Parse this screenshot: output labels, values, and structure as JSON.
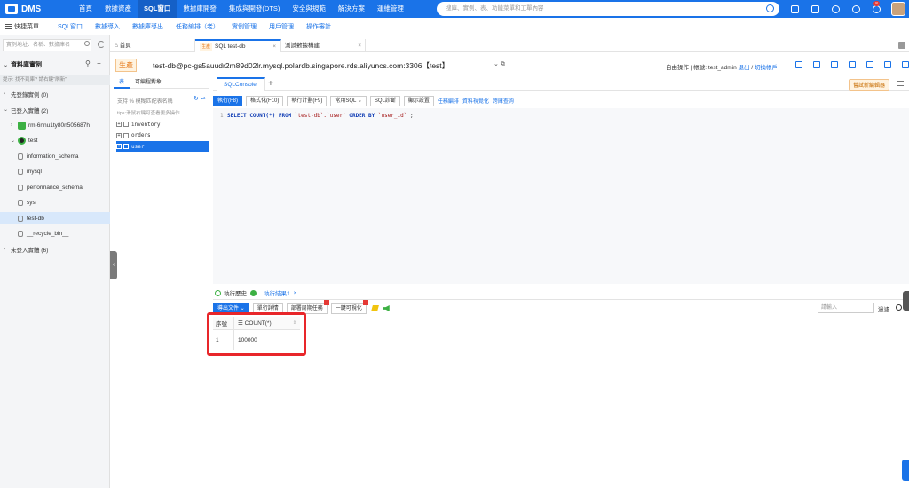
{
  "topnav": {
    "logo": "DMS",
    "items": [
      "首頁",
      "數據資產",
      "SQL窗口",
      "數據庫開發",
      "集成與開發(DTS)",
      "安全與規範",
      "解決方案",
      "運維管理"
    ],
    "active_index": 2,
    "search_placeholder": "搜庫、實例、表、功能菜單和工單內容",
    "notification_count": "8"
  },
  "subnav": {
    "quick_menu": "快捷菜單",
    "items": [
      "SQL窗口",
      "數據導入",
      "數據庫導出",
      "任務編排（老）",
      "實例管理",
      "用戶管理",
      "操作審計"
    ]
  },
  "leftpanel": {
    "search_placeholder": "實例地址、名稱、數據庫名",
    "title": "資料庫實例",
    "hint": "提示: 找不到庫? 請右鍵\"刷新\"",
    "tree": [
      {
        "label": "先登錄實例 (0)",
        "level": 0,
        "arrow": "›"
      },
      {
        "label": "已登入實體 (2)",
        "level": 0,
        "arrow": "⌄"
      },
      {
        "label": "rm-6nnu1ty80n505687h",
        "level": 1,
        "arrow": "›",
        "type": "instance"
      },
      {
        "label": "test",
        "level": 1,
        "arrow": "⌄",
        "type": "instance-dark"
      },
      {
        "label": "information_schema",
        "level": 2,
        "type": "db"
      },
      {
        "label": "mysql",
        "level": 2,
        "type": "db"
      },
      {
        "label": "performance_schema",
        "level": 2,
        "type": "db"
      },
      {
        "label": "sys",
        "level": 2,
        "type": "db"
      },
      {
        "label": "test-db",
        "level": 2,
        "type": "db",
        "selected": true
      },
      {
        "label": "__recycle_bin__",
        "level": 2,
        "type": "db"
      },
      {
        "label": "未登入實體 (6)",
        "level": 0,
        "arrow": "›"
      }
    ]
  },
  "tabs": [
    {
      "label": "首頁",
      "icon": "home-icon"
    },
    {
      "label": "SQL test-db",
      "tag": "生產",
      "active": true
    },
    {
      "label": "測試數據構建"
    }
  ],
  "connection": {
    "env": "生產",
    "text": "test-db@pc-gs5auudr2m89d02lr.mysql.polardb.singapore.rds.aliyuncs.com:3306【test】",
    "mode_label": "自由操作",
    "account_prefix": "| 帳號: test_admin",
    "logout": "退出",
    "switch_account": "切換帳戶"
  },
  "objpanel": {
    "tabs": [
      "表",
      "可編程對象"
    ],
    "search_hint": "支持 % 模糊匹配表名稱",
    "tips": "tips:滑鼠右鍵可查看更多操作...",
    "tables": [
      "inventory",
      "orders",
      "user"
    ],
    "selected_table": "user"
  },
  "editor": {
    "tab": "SQLConsole",
    "try_new": "嘗試新編輯器",
    "toolbar": [
      "執行(F8)",
      "格式化(F10)",
      "執行計劃(F9)",
      "常用SQL ⌄",
      "SQL診斷",
      "顯示設置"
    ],
    "links": [
      "任務編排",
      "資料視覺化",
      "跨庫查詢"
    ],
    "line_number": "1",
    "sql": {
      "kw1": "SELECT",
      "fn": "COUNT(*)",
      "kw2": "FROM",
      "tbl": "`test-db`.`user`",
      "kw3": "ORDER BY",
      "col": "`user_id`",
      "end": ";"
    }
  },
  "results": {
    "history": "執行歷史",
    "result_tab": "執行結果1",
    "toolbar": [
      "導出文件 ⌄",
      "單行詳情",
      "部署周期任務",
      "一鍵可視化"
    ],
    "find_placeholder": "請輸入",
    "find_label": "過濾",
    "columns": [
      "序號",
      "COUNT(*)"
    ],
    "rows": [
      [
        "1",
        "100000"
      ]
    ]
  },
  "colors": {
    "brand": "#1a73e8",
    "env_tag": "#e67e22",
    "highlight": "#e8262a"
  }
}
